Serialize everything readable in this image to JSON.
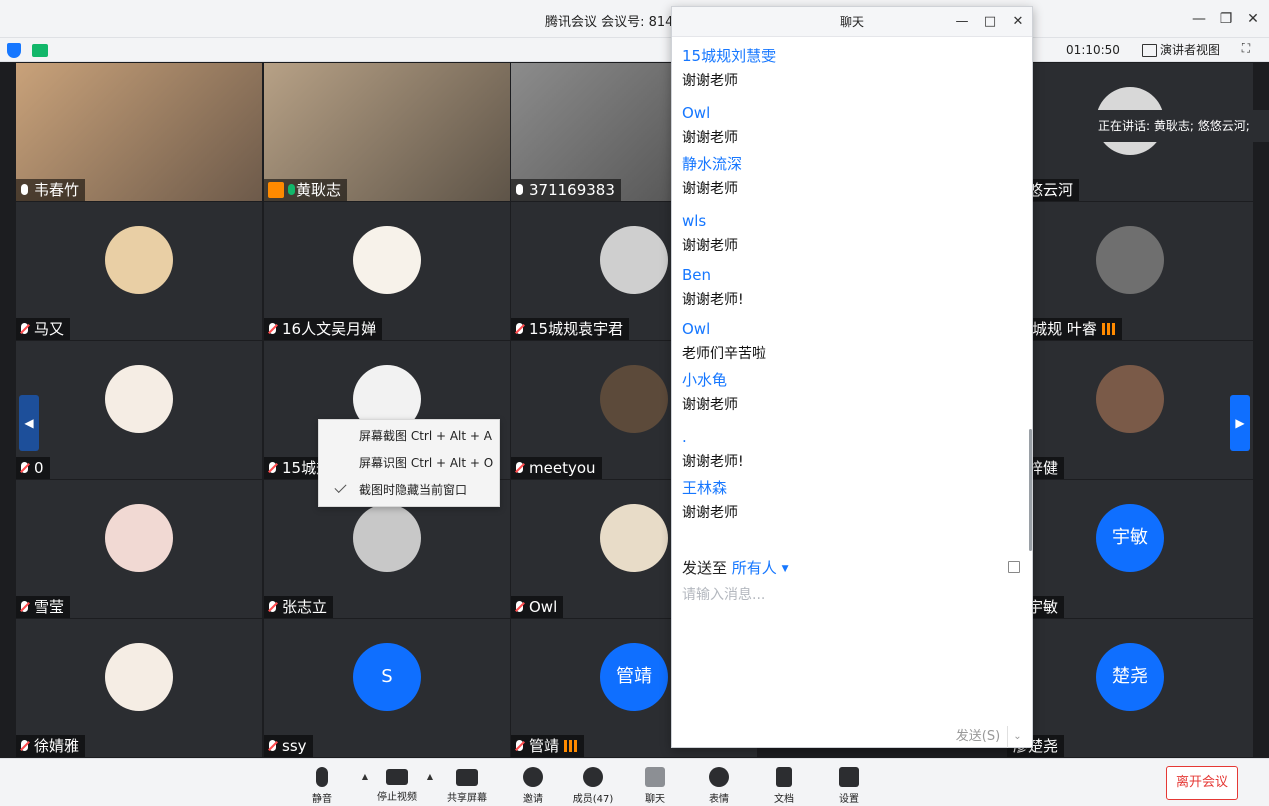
{
  "app": {
    "title": "腾讯会议 会议号: 814",
    "timer": "01:10:50",
    "speaker_view": "演讲者视图",
    "speaking_tip": "正在讲话: 黄耿志; 悠悠云河;"
  },
  "tiles": [
    {
      "name": "韦春竹",
      "video": true,
      "muted": false
    },
    {
      "name": "黄耿志",
      "video": true,
      "muted": false
    },
    {
      "name": "371169383",
      "video": true,
      "muted": false
    },
    {
      "name": "悠悠云河",
      "video": false,
      "muted": false
    },
    {
      "name": "马又",
      "video": false,
      "muted": true
    },
    {
      "name": "16人文吴月婵",
      "video": false,
      "muted": true
    },
    {
      "name": "15城规袁宇君",
      "video": false,
      "muted": true
    },
    {
      "name": "15城规 叶睿",
      "video": false,
      "muted": true,
      "signal": true
    },
    {
      "name": "0",
      "video": false,
      "muted": true
    },
    {
      "name": "15城规刘",
      "video": false,
      "muted": true
    },
    {
      "name": "meetyou",
      "video": false,
      "muted": true
    },
    {
      "name": "李梓健",
      "video": false,
      "muted": true
    },
    {
      "name": "雪莹",
      "video": false,
      "muted": true
    },
    {
      "name": "张志立",
      "video": false,
      "muted": true
    },
    {
      "name": "Owl",
      "video": false,
      "muted": true
    },
    {
      "name": "林宇敏",
      "video": false,
      "muted": true,
      "letter": "宇敏"
    },
    {
      "name": "徐婧雅",
      "video": false,
      "muted": true
    },
    {
      "name": "ssy",
      "video": false,
      "muted": true,
      "letter": "S"
    },
    {
      "name": "管靖",
      "video": false,
      "muted": true,
      "letter": "管靖",
      "signal": true
    },
    {
      "name": "廖楚尧",
      "video": false,
      "muted": true,
      "letter": "楚尧"
    }
  ],
  "context_menu": {
    "items": [
      "屏幕截图 Ctrl + Alt + A",
      "屏幕识图 Ctrl + Alt + O",
      "截图时隐藏当前窗口"
    ]
  },
  "chat": {
    "title": "聊天",
    "messages": [
      {
        "sender": "15城规刘慧雯",
        "text": "谢谢老师"
      },
      {
        "sender": "Owl",
        "text": "谢谢老师"
      },
      {
        "sender": "静水流深",
        "text": "谢谢老师"
      },
      {
        "sender": "wls",
        "text": "谢谢老师"
      },
      {
        "sender": "Ben",
        "text": "谢谢老师!"
      },
      {
        "sender": "Owl",
        "text": "老师们辛苦啦"
      },
      {
        "sender": "小水龟",
        "text": "谢谢老师"
      },
      {
        "sender": ".",
        "text": "谢谢老师!"
      },
      {
        "sender": "王林森",
        "text": "谢谢老师"
      }
    ],
    "send_to_label": "发送至",
    "send_to_target": "所有人",
    "input_placeholder": "请输入消息...",
    "send_label": "发送(S)"
  },
  "toolbar": {
    "mute": "静音",
    "stop_video": "停止视频",
    "share_screen": "共享屏幕",
    "invite": "邀请",
    "members": "成员(47)",
    "chat": "聊天",
    "emoji": "表情",
    "docs": "文档",
    "settings": "设置",
    "leave": "离开会议"
  },
  "colors": {
    "accent": "#1677ff",
    "danger": "#e53935",
    "tile_bg": "#2b2d31"
  }
}
